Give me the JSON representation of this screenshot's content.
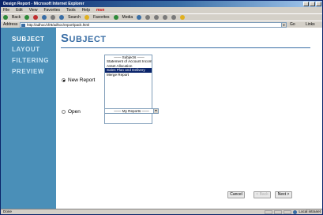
{
  "window": {
    "title": "Design Report - Microsoft Internet Explorer"
  },
  "menu": [
    "File",
    "Edit",
    "View",
    "Favorites",
    "Tools",
    "Help"
  ],
  "menu_brand": "msn",
  "toolbar": {
    "back": "Back",
    "search": "Search",
    "favorites": "Favorites",
    "media": "Media"
  },
  "address": {
    "label": "Address",
    "url": "http://adhoc/cfr8/adhoc/report/pack.html",
    "go": "Go",
    "links": "Links"
  },
  "sidebar": {
    "items": [
      "SUBJECT",
      "LAYOUT",
      "FILTERING",
      "PREVIEW"
    ],
    "active_index": 0
  },
  "page": {
    "title": "Subject"
  },
  "new_report": {
    "label": "New Report",
    "checked": true,
    "listbox_header": "—— Subjects ——",
    "subjects": [
      "Statement of Account Income",
      "Asset Allocation",
      "Sales Plan and Delivery",
      "Merge Report"
    ],
    "selected_index": 2
  },
  "open": {
    "label": "Open",
    "checked": false,
    "select_value": "—— My Reports ——"
  },
  "buttons": {
    "cancel": "Cancel",
    "back": "< Back",
    "next": "Next >"
  },
  "status": {
    "left": "Done",
    "zone": "Local intranet"
  },
  "colors": {
    "sidebar_bg": "#4a8fb8",
    "title_color": "#3a6ea5",
    "selection_bg": "#0a246a"
  }
}
